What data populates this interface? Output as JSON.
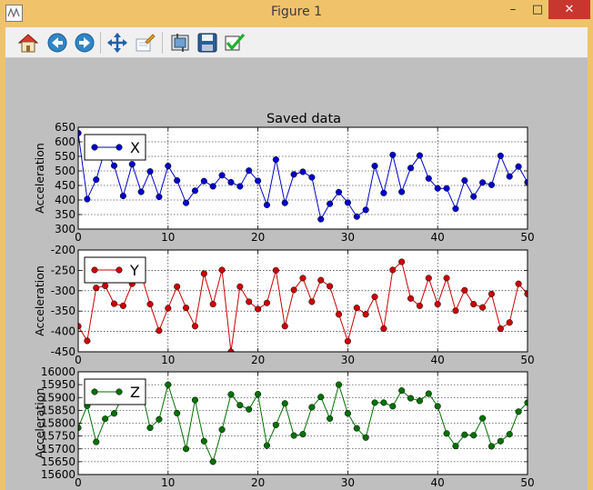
{
  "window": {
    "title": "Figure 1",
    "minimize_glyph": "–",
    "maximize_glyph": "□",
    "close_glyph": "✕"
  },
  "toolbar": {
    "icons": [
      "home-icon",
      "back-icon",
      "forward-icon",
      "pan-icon",
      "zoom-icon",
      "subplots-icon",
      "save-icon",
      "check-icon"
    ]
  },
  "colors": {
    "x": "#0000cc",
    "y": "#cc0000",
    "z": "#007000"
  },
  "chart_data": {
    "title": "Saved data",
    "type": "line",
    "grid": true,
    "subplots": [
      {
        "key": "x",
        "type": "line",
        "legend": "X",
        "legend_position": "top-left",
        "ylabel": "Acceleration",
        "xlim": [
          0,
          50
        ],
        "ylim": [
          300,
          650
        ],
        "xticks": [
          0,
          10,
          20,
          30,
          40,
          50
        ],
        "yticks": [
          300,
          350,
          400,
          450,
          500,
          550,
          600,
          650
        ],
        "y": [
          630,
          403,
          470,
          575,
          518,
          414,
          523,
          428,
          498,
          411,
          517,
          467,
          390,
          432,
          465,
          447,
          485,
          461,
          447,
          501,
          466,
          383,
          539,
          390,
          488,
          497,
          478,
          334,
          387,
          427,
          391,
          343,
          366,
          517,
          424,
          555,
          428,
          510,
          553,
          474,
          440,
          440,
          370,
          467,
          412,
          460,
          452,
          552,
          481,
          515,
          461
        ]
      },
      {
        "key": "y",
        "type": "line",
        "legend": "Y",
        "legend_position": "top-left",
        "ylabel": "Acceleration",
        "xlim": [
          0,
          50
        ],
        "ylim": [
          -450,
          -200
        ],
        "xticks": [
          0,
          10,
          20,
          30,
          40,
          50
        ],
        "yticks": [
          -450,
          -400,
          -350,
          -300,
          -250,
          -200
        ],
        "y": [
          -387,
          -423,
          -293,
          -288,
          -332,
          -337,
          -283,
          -260,
          -333,
          -398,
          -343,
          -290,
          -342,
          -387,
          -258,
          -333,
          -249,
          -450,
          -290,
          -327,
          -345,
          -330,
          -250,
          -387,
          -298,
          -269,
          -327,
          -274,
          -289,
          -358,
          -424,
          -342,
          -358,
          -315,
          -393,
          -249,
          -229,
          -319,
          -337,
          -269,
          -333,
          -269,
          -349,
          -299,
          -333,
          -341,
          -308,
          -393,
          -378,
          -283,
          -308
        ]
      },
      {
        "key": "z",
        "type": "line",
        "legend": "Z",
        "legend_position": "top-left",
        "ylabel": "Acceleration",
        "xlim": [
          0,
          50
        ],
        "ylim": [
          15600,
          16000
        ],
        "xticks": [
          0,
          10,
          20,
          30,
          40,
          50
        ],
        "yticks": [
          15600,
          15650,
          15700,
          15750,
          15800,
          15850,
          15900,
          15950,
          16000
        ],
        "y": [
          15782,
          15868,
          15727,
          15817,
          15838,
          15907,
          15913,
          15938,
          15782,
          15815,
          15950,
          15839,
          15700,
          15890,
          15730,
          15650,
          15775,
          15912,
          15870,
          15854,
          15913,
          15713,
          15793,
          15877,
          15752,
          15757,
          15862,
          15902,
          15818,
          15950,
          15838,
          15780,
          15744,
          15880,
          15880,
          15866,
          15927,
          15897,
          15887,
          15915,
          15866,
          15760,
          15711,
          15755,
          15753,
          15819,
          15710,
          15730,
          15757,
          15845,
          15880
        ]
      }
    ]
  }
}
